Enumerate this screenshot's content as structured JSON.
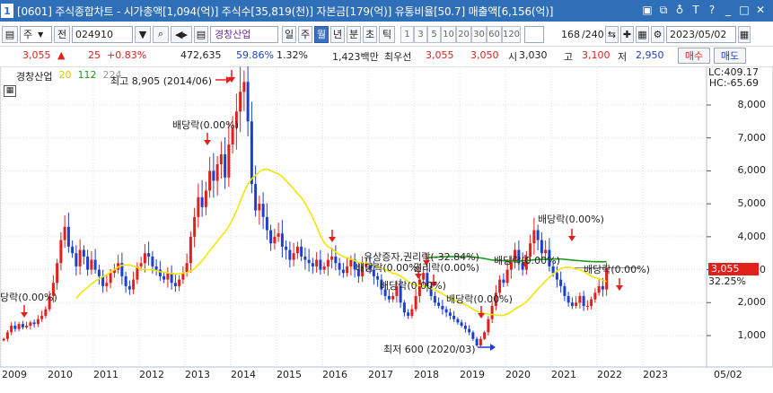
{
  "window": {
    "number": "1",
    "title": "[0601] 주식종합차트 - 시가총액[1,094(억)] 주식수[35,819(천)] 자본금[179(억)] 유통비율[50.7] 매출액[6,156(억)]",
    "icons": [
      "save-icon",
      "window-icon",
      "pin-icon",
      "text-icon",
      "help-icon",
      "minimize-icon",
      "maximize-icon",
      "close-icon"
    ]
  },
  "toolbar": {
    "market": "주",
    "all_btn": "전",
    "code": "024910",
    "stock_name": "경창산업",
    "periods": [
      "일",
      "주",
      "월",
      "년",
      "분",
      "초",
      "틱"
    ],
    "selected_period": "월",
    "intervals": [
      "1",
      "3",
      "5",
      "10",
      "20",
      "30",
      "60",
      "120"
    ],
    "count": "168",
    "count_total": "/240",
    "date": "2023/05/02"
  },
  "quote": {
    "price": "3,055",
    "change_icon": "up-triangle",
    "change": "25",
    "change_pct": "+0.83%",
    "volume": "472,635",
    "turnover_pct": "59.86%",
    "vol_ratio": "1.32%",
    "amount": "1,423백만",
    "best_ask_label": "최우선",
    "best_ask": "3,055",
    "best_bid": "3,050",
    "open_label": "시",
    "open": "3,030",
    "high_label": "고",
    "high": "3,100",
    "low_label": "저",
    "low": "2,950",
    "buy": "매수",
    "sell": "매도"
  },
  "legend": {
    "name": "경창산업",
    "ma1": "20",
    "ma2": "112",
    "ma3": "224"
  },
  "scale": {
    "lc": "LC:409.17",
    "hc": "HC:-65.69",
    "price_box": "3,055",
    "pct_label": "32.25%"
  },
  "annotations": {
    "high": "최고 8,905 (2014/06)",
    "low": "최저 600 (2020/03)",
    "div_2014": "배당락(0.00%)",
    "div_2010": "당락(0.00%)",
    "rights": "유상증자,권리락(-32.84%)",
    "div_2018a": "배당락(0.00%)",
    "div_2018b": "권리락(0.00%)",
    "div_2018c": "배당락(0.00%)",
    "div_2019": "배당락(0.00%)",
    "div_2020": "배당락(0.00%)",
    "div_2021": "배당락(0.00%)",
    "div_2022": "배당락(0.00%)"
  },
  "chart_data": {
    "type": "candlestick",
    "interval": "monthly",
    "y_ticks": [
      "8,000",
      "7,000",
      "6,000",
      "5,000",
      "4,000",
      "3,000",
      "2,000",
      "1,000"
    ],
    "x_ticks": [
      "2009",
      "2010",
      "2011",
      "2012",
      "2013",
      "2014",
      "2015",
      "2016",
      "2017",
      "2018",
      "2019",
      "2020",
      "2021",
      "2022",
      "2023"
    ],
    "x_end_label": "05/02",
    "ylim": [
      400,
      9300
    ],
    "ma_colors": {
      "ma20": "#f2e600",
      "ma112": "#1a9a1a",
      "ma224": "#999999"
    },
    "up_color": "#e0201b",
    "down_color": "#1c3fd0",
    "monthly_closes": [
      900,
      1100,
      1300,
      1200,
      1350,
      1250,
      1300,
      1400,
      1350,
      1500,
      1600,
      1800,
      2200,
      2600,
      3200,
      3900,
      4300,
      3700,
      3500,
      3100,
      3600,
      3400,
      3000,
      3300,
      3000,
      2800,
      2500,
      2600,
      2900,
      3000,
      3200,
      2800,
      2500,
      2400,
      2700,
      3100,
      3200,
      3500,
      3400,
      3100,
      3000,
      2800,
      2700,
      2900,
      2600,
      2500,
      2700,
      2900,
      3200,
      4000,
      4600,
      5200,
      4900,
      5400,
      6000,
      5700,
      6200,
      6500,
      5800,
      6800,
      7300,
      7800,
      8400,
      8700,
      7500,
      5600,
      4800,
      5000,
      4600,
      4200,
      3800,
      4000,
      4100,
      3700,
      3600,
      3300,
      3500,
      3700,
      3400,
      3300,
      3200,
      3100,
      3300,
      3000,
      3100,
      3300,
      3400,
      3200,
      3000,
      2900,
      3100,
      3300,
      3000,
      2800,
      3100,
      3200,
      3000,
      2800,
      2700,
      2400,
      2200,
      2100,
      2200,
      2500,
      2000,
      1700,
      1600,
      1800,
      2200,
      2700,
      2900,
      2500,
      2200,
      2000,
      1900,
      1800,
      1700,
      1600,
      1500,
      1400,
      1300,
      1200,
      1100,
      900,
      700,
      900,
      1100,
      1500,
      1900,
      2300,
      2700,
      2600,
      3000,
      3300,
      3600,
      3200,
      3000,
      3400,
      3800,
      4200,
      3900,
      3500,
      3600,
      3100,
      2900,
      2700,
      2500,
      2200,
      2000,
      1900,
      2000,
      2200,
      1900,
      1900,
      2100,
      2300,
      2500,
      2400,
      3055
    ]
  }
}
